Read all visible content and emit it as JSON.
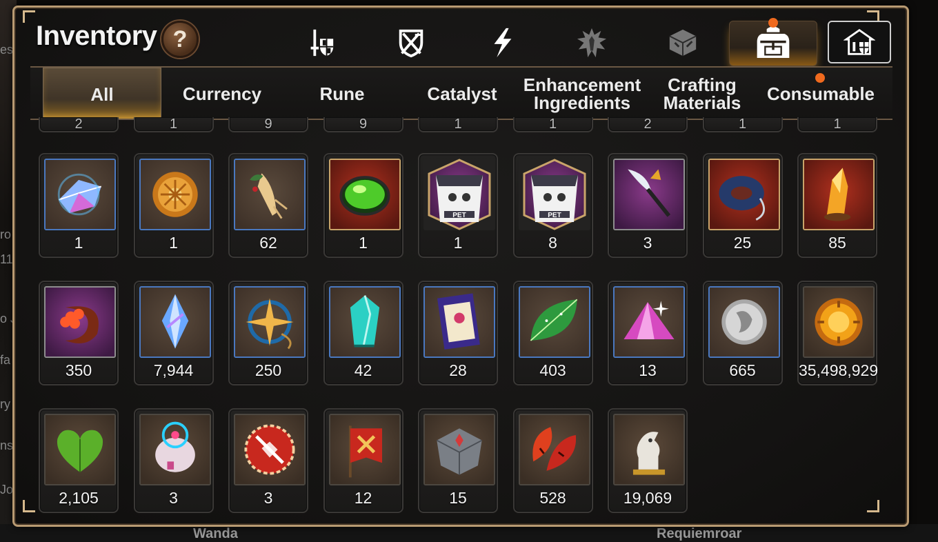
{
  "background": {
    "left_fragments": [
      "es",
      "ro",
      "11",
      "o J",
      "fa",
      "ry",
      "ns",
      "Jo"
    ],
    "bottom_names": [
      "Wanda",
      "Requiemroar"
    ]
  },
  "header": {
    "title": "Inventory",
    "help_label": "?"
  },
  "top_tabs": [
    {
      "icon": "sword-shield-icon"
    },
    {
      "icon": "crossed-weapons-shield-icon"
    },
    {
      "icon": "lightning-icon"
    },
    {
      "icon": "hero-silhouette-icon"
    },
    {
      "icon": "cube-rune-icon"
    },
    {
      "icon": "backpack-icon",
      "active": true
    },
    {
      "icon": "castle-gate-icon"
    }
  ],
  "categories": [
    {
      "label": "All",
      "active": true
    },
    {
      "label": "Currency"
    },
    {
      "label": "Rune"
    },
    {
      "label": "Catalyst"
    },
    {
      "label": "Enhancement\nIngredients"
    },
    {
      "label": "Crafting\nMaterials"
    },
    {
      "label": "Consumable",
      "notify": true
    }
  ],
  "partial_row_counts": [
    "2",
    "1",
    "9",
    "9",
    "1",
    "1",
    "2",
    "1",
    "1"
  ],
  "items": [
    {
      "count": "1",
      "icon": "prism-crystal-icon",
      "bg": "blue"
    },
    {
      "count": "1",
      "icon": "sun-coin-icon",
      "bg": "blue"
    },
    {
      "count": "62",
      "icon": "ginseng-root-icon",
      "bg": "blue"
    },
    {
      "count": "1",
      "icon": "green-orb-icon",
      "bg": "red"
    },
    {
      "count": "1",
      "icon": "pet-pack-icon",
      "bg": "purple"
    },
    {
      "count": "8",
      "icon": "pet-pack-icon",
      "bg": "purple"
    },
    {
      "count": "3",
      "icon": "feather-wand-icon",
      "bg": "purple"
    },
    {
      "count": "25",
      "icon": "rope-ring-icon",
      "bg": "red"
    },
    {
      "count": "85",
      "icon": "amber-crystal-icon",
      "bg": "red"
    },
    {
      "count": "350",
      "icon": "flower-crescent-icon",
      "bg": "purple"
    },
    {
      "count": "7,944",
      "icon": "blue-crystal-icon",
      "bg": "blue"
    },
    {
      "count": "250",
      "icon": "star-compass-icon",
      "bg": "blue"
    },
    {
      "count": "42",
      "icon": "teal-crystal-icon",
      "bg": "blue"
    },
    {
      "count": "28",
      "icon": "certificate-card-icon",
      "bg": "blue"
    },
    {
      "count": "403",
      "icon": "green-leaf-icon",
      "bg": "blue"
    },
    {
      "count": "13",
      "icon": "pink-crystal-icon",
      "bg": "blue"
    },
    {
      "count": "665",
      "icon": "silver-coin-icon",
      "bg": "blue"
    },
    {
      "count": "35,498,929",
      "icon": "gold-coin-icon",
      "bg": "brown"
    },
    {
      "count": "2,105",
      "icon": "green-heart-icon",
      "bg": "brown"
    },
    {
      "count": "3",
      "icon": "robot-pod-icon",
      "bg": "brown"
    },
    {
      "count": "3",
      "icon": "red-badge-icon",
      "bg": "brown"
    },
    {
      "count": "12",
      "icon": "war-banner-icon",
      "bg": "brown"
    },
    {
      "count": "15",
      "icon": "stone-gem-icon",
      "bg": "brown"
    },
    {
      "count": "528",
      "icon": "red-leaves-icon",
      "bg": "brown"
    },
    {
      "count": "19,069",
      "icon": "chess-knight-icon",
      "bg": "brown"
    }
  ],
  "colors": {
    "frame": "#b89a72",
    "notify_dot": "#f06a1e",
    "active_glow": "#ffb840"
  }
}
